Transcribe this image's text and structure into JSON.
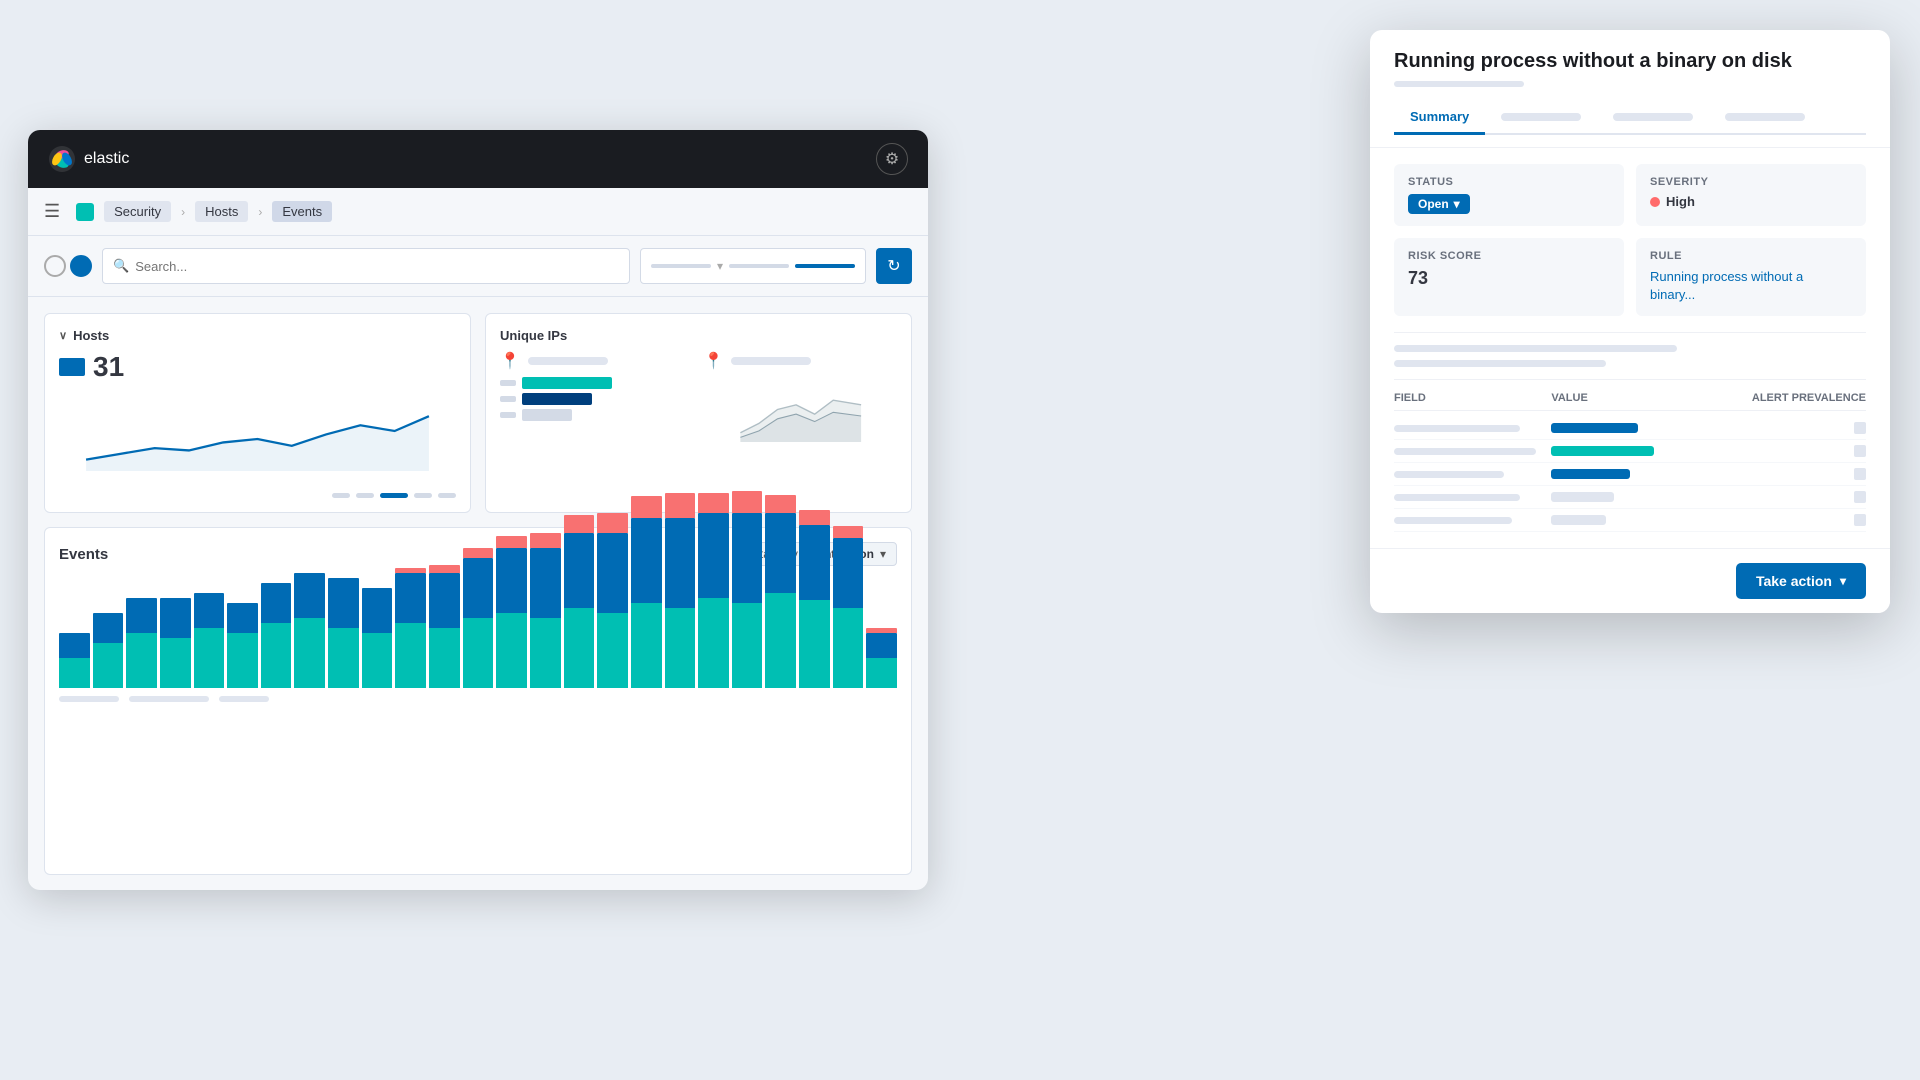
{
  "app": {
    "name": "elastic",
    "logo_text": "elastic"
  },
  "breadcrumb": {
    "items": [
      "Security",
      "Hosts",
      "Events"
    ]
  },
  "search": {
    "placeholder": "Search..."
  },
  "hosts_widget": {
    "title": "Hosts",
    "count": "31",
    "pagination": [
      "",
      "",
      "",
      "",
      ""
    ]
  },
  "unique_ips_widget": {
    "title": "Unique IPs"
  },
  "events_widget": {
    "title": "Events",
    "stack_by_label": "Stack by",
    "stack_by_value": "event.action"
  },
  "flyout": {
    "title": "Running process without a binary on disk",
    "tabs": [
      "Summary",
      "",
      "",
      ""
    ],
    "status_label": "Status",
    "status_value": "Open",
    "severity_label": "Severity",
    "severity_value": "High",
    "risk_score_label": "Risk Score",
    "risk_score_value": "73",
    "rule_label": "Rule",
    "rule_value": "Running process without a binary...",
    "field_table": {
      "col_field": "Field",
      "col_value": "Value",
      "col_alert": "Alert prevalence",
      "rows": [
        {
          "value_color": "#006bb4",
          "value_width": "55%"
        },
        {
          "value_color": "#00bfb3",
          "value_width": "65%"
        },
        {
          "value_color": "#006bb4",
          "value_width": "50%"
        },
        {
          "value_color": "#e0e5ef",
          "value_width": "40%"
        },
        {
          "value_color": "#e0e5ef",
          "value_width": "35%"
        }
      ]
    },
    "take_action_label": "Take action"
  },
  "bars": {
    "colors": {
      "blue_dark": "#003f7d",
      "blue_mid": "#006bb4",
      "teal": "#00bfb3",
      "pink": "#f87171",
      "gray": "#b0bec5"
    },
    "groups": [
      {
        "teal": 30,
        "blue": 25,
        "pink": 0
      },
      {
        "teal": 45,
        "blue": 30,
        "pink": 0
      },
      {
        "teal": 55,
        "blue": 35,
        "pink": 0
      },
      {
        "teal": 50,
        "blue": 40,
        "pink": 0
      },
      {
        "teal": 60,
        "blue": 35,
        "pink": 0
      },
      {
        "teal": 55,
        "blue": 30,
        "pink": 0
      },
      {
        "teal": 65,
        "blue": 40,
        "pink": 0
      },
      {
        "teal": 70,
        "blue": 45,
        "pink": 0
      },
      {
        "teal": 60,
        "blue": 50,
        "pink": 0
      },
      {
        "teal": 55,
        "blue": 45,
        "pink": 0
      },
      {
        "teal": 65,
        "blue": 50,
        "pink": 5
      },
      {
        "teal": 60,
        "blue": 55,
        "pink": 8
      },
      {
        "teal": 70,
        "blue": 60,
        "pink": 10
      },
      {
        "teal": 75,
        "blue": 65,
        "pink": 12
      },
      {
        "teal": 70,
        "blue": 70,
        "pink": 15
      },
      {
        "teal": 80,
        "blue": 75,
        "pink": 18
      },
      {
        "teal": 75,
        "blue": 80,
        "pink": 20
      },
      {
        "teal": 85,
        "blue": 85,
        "pink": 22
      },
      {
        "teal": 80,
        "blue": 90,
        "pink": 25
      },
      {
        "teal": 90,
        "blue": 85,
        "pink": 20
      },
      {
        "teal": 85,
        "blue": 90,
        "pink": 22
      },
      {
        "teal": 95,
        "blue": 80,
        "pink": 18
      },
      {
        "teal": 88,
        "blue": 75,
        "pink": 15
      },
      {
        "teal": 80,
        "blue": 70,
        "pink": 12
      },
      {
        "teal": 30,
        "blue": 25,
        "pink": 5
      }
    ]
  }
}
